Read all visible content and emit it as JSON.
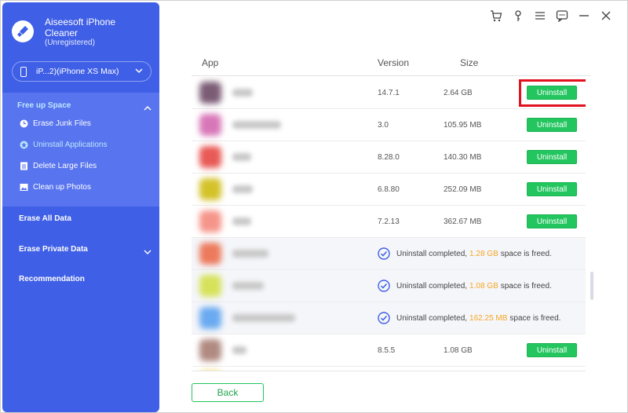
{
  "brand": {
    "title": "Aiseesoft iPhone Cleaner",
    "subtitle": "(Unregistered)"
  },
  "device": {
    "label": "iP...2)(iPhone XS Max)"
  },
  "sidebar": {
    "free_up_space": "Free up Space",
    "sub_items": [
      {
        "label": "Erase Junk Files",
        "icon": "clock-icon"
      },
      {
        "label": "Uninstall Applications",
        "icon": "star-icon"
      },
      {
        "label": "Delete Large Files",
        "icon": "file-icon"
      },
      {
        "label": "Clean up Photos",
        "icon": "photo-icon"
      }
    ],
    "erase_all": "Erase All Data",
    "erase_private": "Erase Private Data",
    "recommendation": "Recommendation"
  },
  "toolbar_icons": [
    "cart-icon",
    "key-icon",
    "menu-icon",
    "feedback-icon",
    "minimize-icon",
    "close-icon"
  ],
  "table": {
    "headers": {
      "app": "App",
      "version": "Version",
      "size": "Size"
    },
    "uninstall_label": "Uninstall",
    "rows": [
      {
        "version": "14.7.1",
        "size": "2.64 GB",
        "status": "installed"
      },
      {
        "version": "3.0",
        "size": "105.95 MB",
        "status": "installed"
      },
      {
        "version": "8.28.0",
        "size": "140.30 MB",
        "status": "installed"
      },
      {
        "version": "6.8.80",
        "size": "252.09 MB",
        "status": "installed"
      },
      {
        "version": "7.2.13",
        "size": "362.67 MB",
        "status": "installed"
      },
      {
        "status": "completed",
        "msg_prefix": "Uninstall completed,",
        "freed": "1.28 GB",
        "msg_suffix": "space is freed."
      },
      {
        "status": "completed",
        "msg_prefix": "Uninstall completed,",
        "freed": "1.08 GB",
        "msg_suffix": "space is freed."
      },
      {
        "status": "completed",
        "msg_prefix": "Uninstall completed,",
        "freed": "162.25 MB",
        "msg_suffix": "space is freed."
      },
      {
        "version": "8.5.5",
        "size": "1.08 GB",
        "status": "installed"
      }
    ]
  },
  "back_label": "Back",
  "colors": {
    "sidebar": "#3f5fe6",
    "accent_green": "#22c55e",
    "freed_orange": "#f5a623",
    "highlight_red": "#e3101e"
  }
}
